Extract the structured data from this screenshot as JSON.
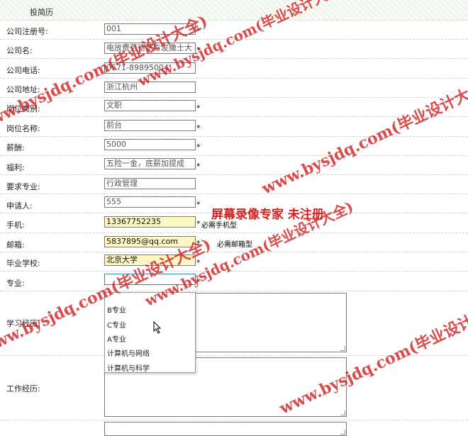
{
  "header": {
    "title": "投简历"
  },
  "fields": [
    {
      "label": "公司注册号:",
      "value": "001",
      "required": "*"
    },
    {
      "label": "公司名:",
      "value": "电放费范德萨方发撒士大",
      "required": "*"
    },
    {
      "label": "公司电话:",
      "value": "0571-89895004",
      "required": ""
    },
    {
      "label": "公司地址:",
      "value": "浙江杭州",
      "required": ""
    },
    {
      "label": "岗位类别:",
      "value": "文职",
      "required": "*"
    },
    {
      "label": "岗位名称:",
      "value": "前台",
      "required": "*"
    },
    {
      "label": "薪酬:",
      "value": "5000",
      "required": "*"
    },
    {
      "label": "福利:",
      "value": "五险一金，底薪加提成",
      "required": "*"
    },
    {
      "label": "要求专业:",
      "value": "行政管理",
      "required": ""
    },
    {
      "label": "申请人:",
      "value": "555",
      "required": "*"
    },
    {
      "label": "手机:",
      "value": "13367752235",
      "required": "*",
      "hint": "必需手机型"
    },
    {
      "label": "邮箱:",
      "value": "5837895@qq.com",
      "required": "*",
      "hint": "必需邮箱型"
    },
    {
      "label": "毕业学校:",
      "value": "北京大学",
      "required": "*"
    },
    {
      "label": "专业:",
      "value": "",
      "required": "*"
    }
  ],
  "major_options": [
    "B专业",
    "C专业",
    "A专业",
    "计算机与网络",
    "计算机与科学"
  ],
  "textareas": [
    {
      "label": "学习经历:"
    },
    {
      "label": "工作经历:"
    }
  ],
  "overlay_banner": "屏幕录像专家  未注册",
  "watermark_text": "www.bysjdq.com(毕业设计大全)",
  "colors": {
    "watermark": "#d42020",
    "highlight": "#fff7c2",
    "focus_border": "#3c7fb1"
  }
}
